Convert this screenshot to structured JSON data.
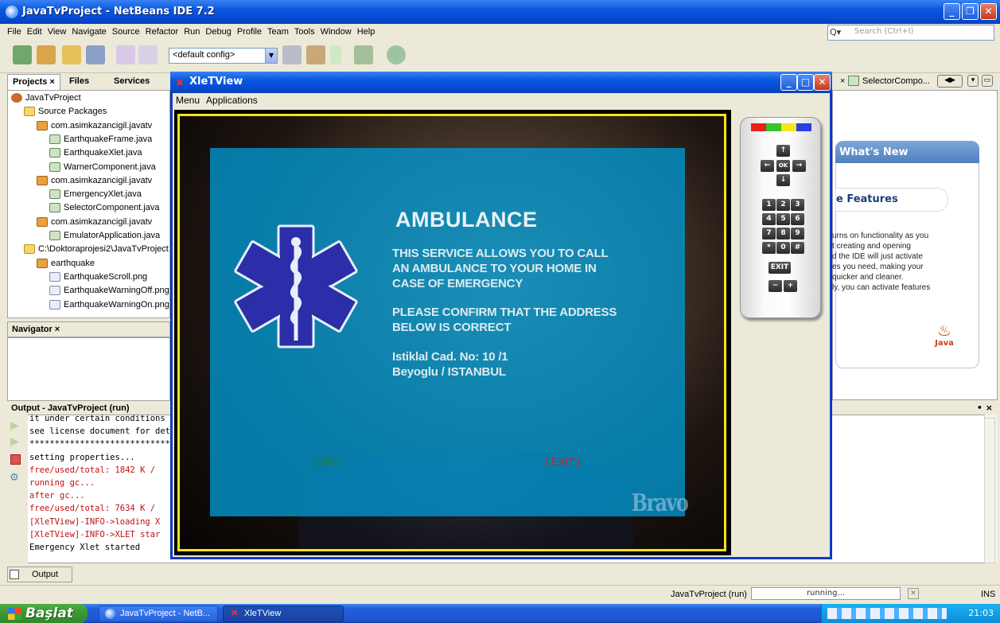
{
  "ide": {
    "title": "JavaTvProject - NetBeans IDE 7.2",
    "menu": [
      "File",
      "Edit",
      "View",
      "Navigate",
      "Source",
      "Refactor",
      "Run",
      "Debug",
      "Profile",
      "Team",
      "Tools",
      "Window",
      "Help"
    ],
    "search_placeholder": "Search (Ctrl+I)",
    "config": "<default config>",
    "tabs": {
      "projects": "Projects",
      "files": "Files",
      "services": "Services"
    },
    "tree": [
      {
        "label": "JavaTvProject",
        "indent": 0,
        "icon": "proj"
      },
      {
        "label": "Source Packages",
        "indent": 1,
        "icon": "folder"
      },
      {
        "label": "com.asimkazancigil.javatv",
        "indent": 2,
        "icon": "pkg"
      },
      {
        "label": "EarthquakeFrame.java",
        "indent": 3,
        "icon": "java"
      },
      {
        "label": "EarthquakeXlet.java",
        "indent": 3,
        "icon": "java"
      },
      {
        "label": "WarnerComponent.java",
        "indent": 3,
        "icon": "java"
      },
      {
        "label": "com.asimkazancigil.javatv",
        "indent": 2,
        "icon": "pkg"
      },
      {
        "label": "EmergencyXlet.java",
        "indent": 3,
        "icon": "java"
      },
      {
        "label": "SelectorComponent.java",
        "indent": 3,
        "icon": "java"
      },
      {
        "label": "com.asimkazancigil.javatv",
        "indent": 2,
        "icon": "pkg"
      },
      {
        "label": "EmulatorApplication.java",
        "indent": 3,
        "icon": "java"
      },
      {
        "label": "C:\\Doktoraprojesi2\\JavaTvProject",
        "indent": 1,
        "icon": "folder"
      },
      {
        "label": "earthquake",
        "indent": 2,
        "icon": "pkg"
      },
      {
        "label": "EarthquakeScroll.png",
        "indent": 3,
        "icon": "png"
      },
      {
        "label": "EarthquakeWarningOff.png",
        "indent": 3,
        "icon": "png"
      },
      {
        "label": "EarthquakeWarningOn.png",
        "indent": 3,
        "icon": "png"
      }
    ],
    "navigator_title": "Navigator",
    "output_title": "Output - JavaTvProject (run)",
    "output_lines": [
      {
        "text": "it under certain conditions",
        "color": "#000"
      },
      {
        "text": "see license document for details",
        "color": "#000"
      },
      {
        "text": "*******************************",
        "color": "#000"
      },
      {
        "text": "setting properties...",
        "color": "#000"
      },
      {
        "text": "free/used/total: 1842 K / ",
        "color": "#c01010"
      },
      {
        "text": "running gc...",
        "color": "#c01010"
      },
      {
        "text": "after gc...",
        "color": "#c01010"
      },
      {
        "text": "free/used/total: 7634 K / ",
        "color": "#c01010"
      },
      {
        "text": "[XleTView]-INFO->loading X",
        "color": "#c01010"
      },
      {
        "text": "[XleTView]-INFO->XLET star",
        "color": "#c01010"
      },
      {
        "text": "Emergency Xlet started",
        "color": "#000"
      }
    ],
    "bottom_tab": "Output",
    "status_project": "JavaTvProject (run)",
    "status_running": "running...",
    "status_ins": "INS",
    "right_tab": "SelectorCompo...",
    "whats_new": "What's New",
    "features": "e Features",
    "features_text": [
      "urns on functionality as you",
      "t creating and opening",
      "d the IDE will just activate",
      "es you need, making your",
      " quicker and cleaner.",
      "ly, you can activate features"
    ],
    "java_logo": "Java"
  },
  "xlet": {
    "title": "XleTView",
    "menu": [
      "Menu",
      "Applications"
    ],
    "heading": "AMBULANCE",
    "paragraph1": [
      "THIS SERVICE ALLOWS YOU TO CALL",
      "AN AMBULANCE TO YOUR HOME IN",
      "CASE OF EMERGENCY"
    ],
    "paragraph2": [
      "PLEASE CONFIRM THAT THE ADDRESS",
      "BELOW IS CORRECT"
    ],
    "address": [
      "Istiklal Cad. No: 10 /1",
      "Beyoglu / ISTANBUL"
    ],
    "ok_label": "[ OK ]",
    "exit_label": "[ EXIT ]",
    "ok_color": "#2e7d20",
    "exit_color": "#c4281e",
    "watermark": "Bravo",
    "remote_keys": [
      "1",
      "2",
      "3",
      "4",
      "5",
      "6",
      "7",
      "8",
      "9",
      "*",
      "0",
      "#"
    ],
    "remote_exit": "EXIT",
    "remote_ok": "OK",
    "remote_minus": "−",
    "remote_plus": "+",
    "color_keys": [
      "#e8211a",
      "#36c42a",
      "#f7e51b",
      "#2a3fe0"
    ]
  },
  "taskbar": {
    "start": "Başlat",
    "items": [
      "JavaTvProject - NetB...",
      "XleTView"
    ],
    "clock": "21:03"
  }
}
